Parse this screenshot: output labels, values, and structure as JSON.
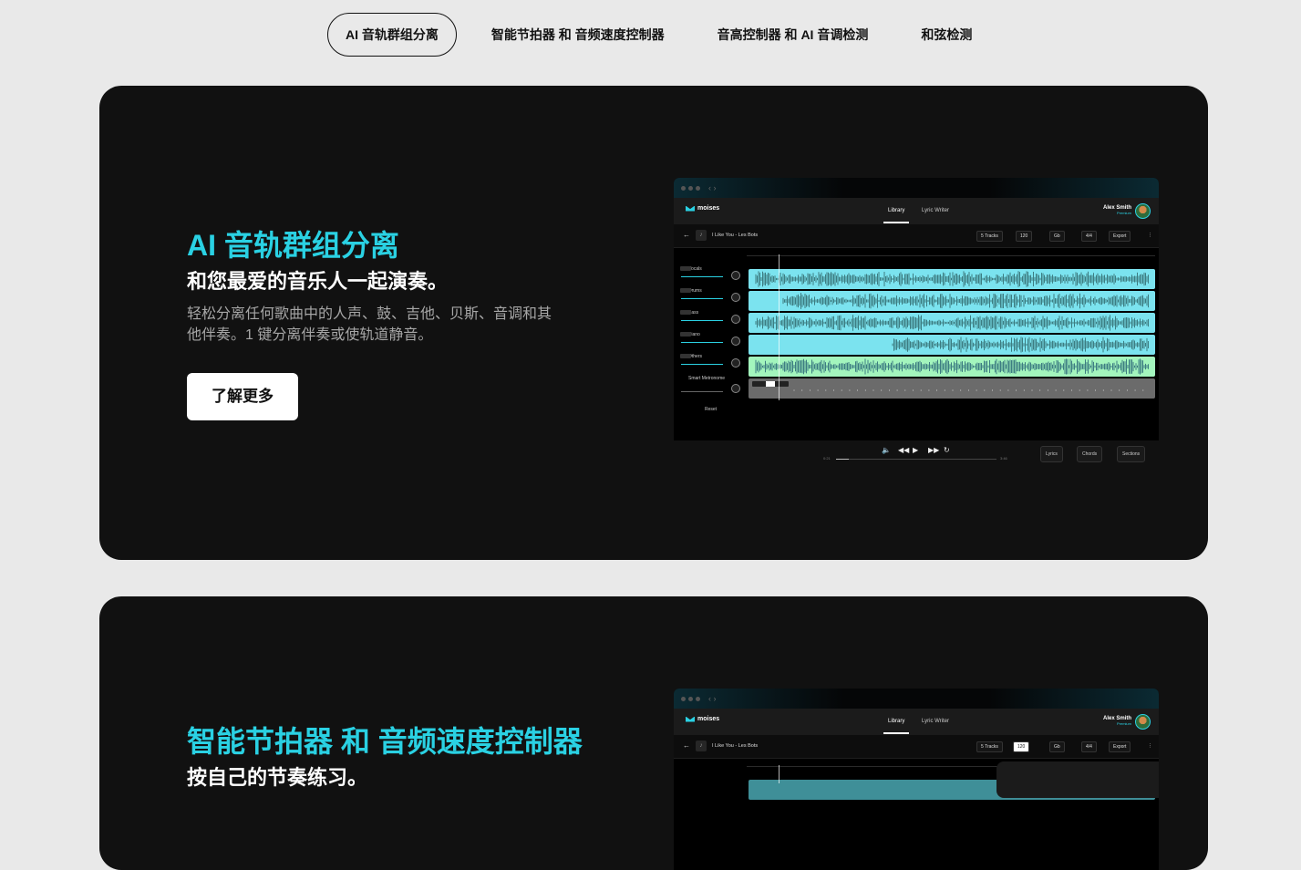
{
  "tabs": [
    {
      "label": "AI 音轨群组分离",
      "active": true
    },
    {
      "label": "智能节拍器 和 音频速度控制器",
      "active": false
    },
    {
      "label": "音高控制器 和 AI 音调检测",
      "active": false
    },
    {
      "label": "和弦检测",
      "active": false
    }
  ],
  "feature1": {
    "title": "AI 音轨群组分离",
    "subtitle": "和您最爱的音乐人一起演奏。",
    "description": "轻松分离任何歌曲中的人声、鼓、吉他、贝斯、音调和其他伴奏。1 键分离伴奏或使轨道静音。",
    "cta": "了解更多"
  },
  "feature2": {
    "title": "智能节拍器 和 音频速度控制器",
    "subtitle": "按自己的节奏练习。"
  },
  "app": {
    "brand": "moises",
    "tabs": [
      "Library",
      "Lyric Writer"
    ],
    "user_name": "Alex Smith",
    "user_plan": "Premium",
    "song": "I Like You - Les Bots",
    "tracks_chip": "5 Tracks",
    "bpm_chip": "120",
    "key_chip": "Gb",
    "time_chip": "4/4",
    "export": "Export",
    "tracks": [
      "Vocals",
      "Drums",
      "Bass",
      "Piano",
      "Others"
    ],
    "metronome": "Smart Metronome",
    "reset": "Reset",
    "time_start": "0:21",
    "time_end": "3:46",
    "progress": 0.08,
    "bottom_buttons": [
      "Lyrics",
      "Chords",
      "Sections"
    ],
    "colors": {
      "accent": "#2ad1e3",
      "track_cyan": "#7be3ef",
      "track_green": "#a3f5bd",
      "metronome": "#6b6b6b"
    }
  }
}
